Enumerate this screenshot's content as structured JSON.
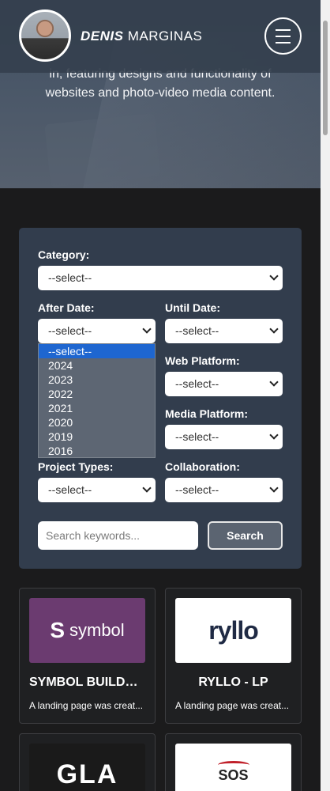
{
  "header": {
    "brand_first": "DENIS",
    "brand_second": "MARGINAS"
  },
  "hero": {
    "line1": "in, featuring designs and functionality of",
    "line2": "websites and photo-video media content."
  },
  "filters": {
    "category": {
      "label": "Category:",
      "value": "--select--"
    },
    "after_date": {
      "label": "After Date:",
      "value": "--select--"
    },
    "until_date": {
      "label": "Until Date:",
      "value": "--select--"
    },
    "web_platform": {
      "label": "Web Platform:",
      "value": "--select--"
    },
    "media_platform": {
      "label": "Media Platform:",
      "value": "--select--"
    },
    "project_types": {
      "label": "Project Types:",
      "value": "--select--"
    },
    "collaboration": {
      "label": "Collaboration:",
      "value": "--select--"
    },
    "after_date_options": [
      "--select--",
      "2024",
      "2023",
      "2022",
      "2021",
      "2020",
      "2019",
      "2016"
    ]
  },
  "search": {
    "placeholder": "Search keywords...",
    "button": "Search"
  },
  "cards": [
    {
      "title": "SYMBOL BUILDCO...",
      "desc": "A landing page was creat...",
      "logo": "symbol",
      "logo_s": "S",
      "logo_text": "symbol"
    },
    {
      "title": "RYLLO - LP",
      "desc": "A landing page was creat...",
      "logo": "ryllo",
      "logo_text": "ryllo"
    },
    {
      "title": "",
      "desc": "",
      "logo": "gla",
      "logo_text": "GLA"
    },
    {
      "title": "",
      "desc": "",
      "logo": "sos",
      "logo_text": "SOS"
    }
  ],
  "colors": {
    "panel": "#323d4d",
    "accent_selected": "#1e66d0",
    "background": "#1b1b1c"
  }
}
